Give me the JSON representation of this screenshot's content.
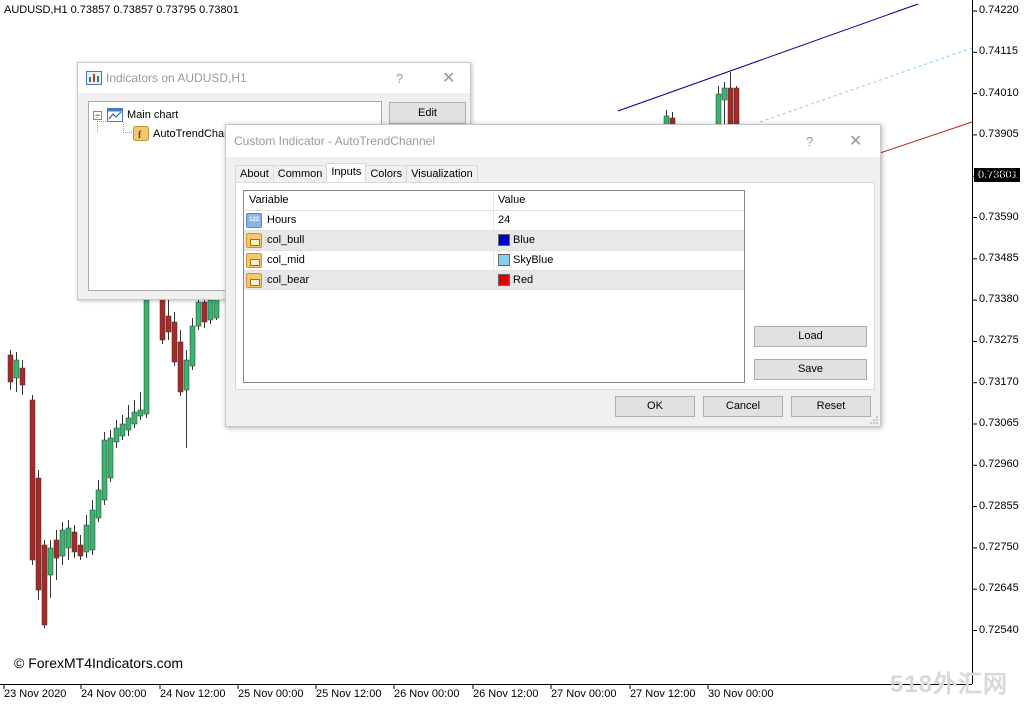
{
  "chart": {
    "symbol_info": "AUDUSD,H1  0.73857 0.73857 0.73795 0.73801",
    "watermark": "© ForexMT4Indicators.com",
    "corner_watermark": "518外汇网",
    "current_price": "0.73801",
    "price_labels": [
      "0.74220",
      "0.74115",
      "0.74010",
      "0.73905",
      "0.73695",
      "0.73590",
      "0.73485",
      "0.73380",
      "0.73275",
      "0.73170",
      "0.73065",
      "0.72960",
      "0.72855",
      "0.72750",
      "0.72645",
      "0.72540"
    ],
    "time_labels": [
      "23 Nov 2020",
      "24 Nov 00:00",
      "24 Nov 12:00",
      "25 Nov 00:00",
      "25 Nov 12:00",
      "26 Nov 00:00",
      "26 Nov 12:00",
      "27 Nov 00:00",
      "27 Nov 12:00",
      "30 Nov 00:00"
    ],
    "colors": {
      "bull": "#3cb371",
      "bear": "#a52a2a",
      "channel_bull": "#00008b",
      "channel_mid": "#87ceeb",
      "channel_bear": "#b22222"
    }
  },
  "indicators_dialog": {
    "title": "Indicators on AUDUSD,H1",
    "help": "?",
    "close": "✕",
    "tree": {
      "root": "Main chart",
      "child": "AutoTrendChar"
    },
    "edit_label": "Edit"
  },
  "custom_dialog": {
    "title": "Custom Indicator - AutoTrendChannel",
    "help": "?",
    "close": "✕",
    "tabs": [
      "About",
      "Common",
      "Inputs",
      "Colors",
      "Visualization"
    ],
    "active_tab": "Inputs",
    "grid": {
      "headers": {
        "variable": "Variable",
        "value": "Value"
      },
      "rows": [
        {
          "icon": "123",
          "variable": "Hours",
          "value": "24"
        },
        {
          "icon": "color",
          "variable": "col_bull",
          "value": "Blue",
          "swatch": "#0000cd"
        },
        {
          "icon": "color",
          "variable": "col_mid",
          "value": "SkyBlue",
          "swatch": "#87ceeb"
        },
        {
          "icon": "color",
          "variable": "col_bear",
          "value": "Red",
          "swatch": "#e00000"
        }
      ]
    },
    "buttons": {
      "load": "Load",
      "save": "Save",
      "ok": "OK",
      "cancel": "Cancel",
      "reset": "Reset"
    }
  }
}
